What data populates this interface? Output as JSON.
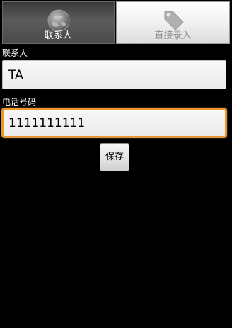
{
  "tabs": [
    {
      "label": "联系人",
      "icon": "globe-contacts-icon",
      "selected": true
    },
    {
      "label": "直接录入",
      "icon": "tag-icon",
      "selected": false
    }
  ],
  "form": {
    "contact_label": "联系人",
    "contact_value": "TA",
    "phone_label": "电话号码",
    "phone_value": "1111111111",
    "save_label": "保存"
  },
  "colors": {
    "background": "#000000",
    "focus_border": "#f29727",
    "status_mark": "#c02020"
  }
}
